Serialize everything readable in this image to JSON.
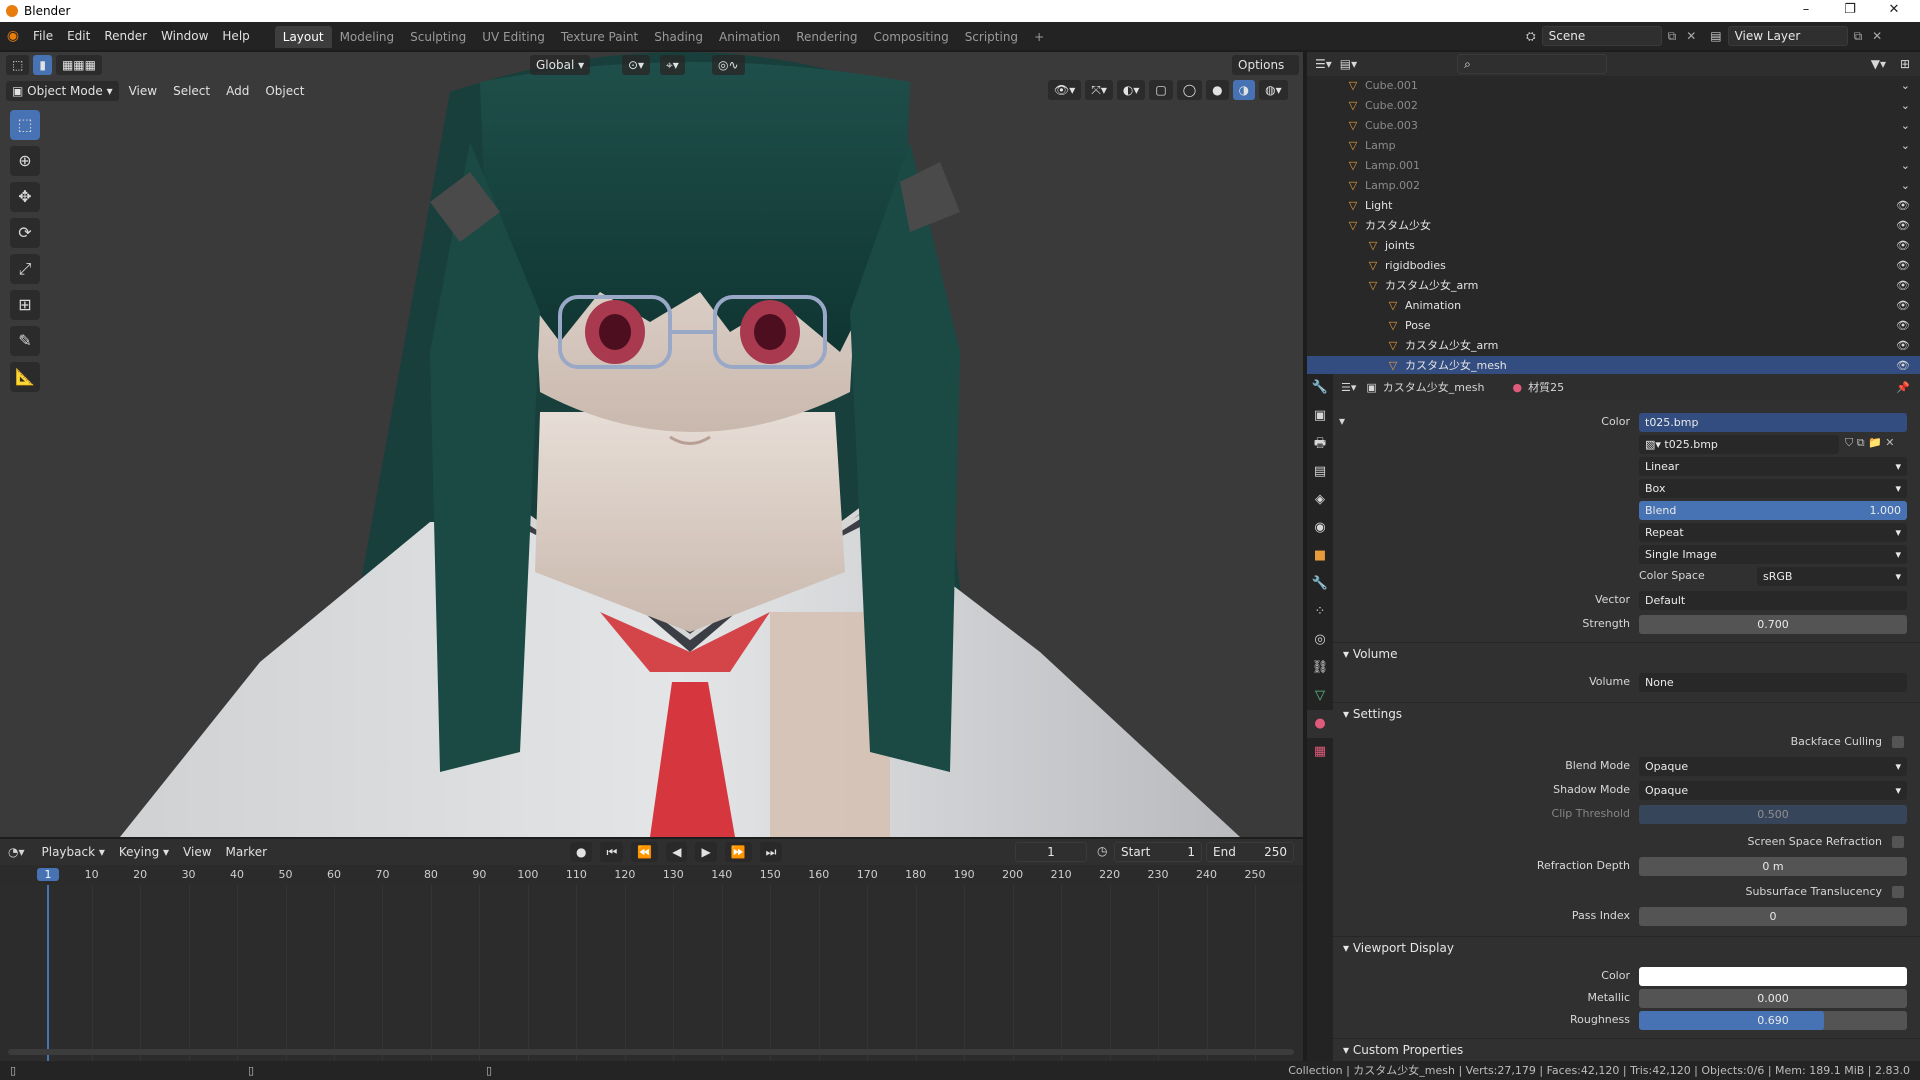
{
  "app": {
    "title": "Blender"
  },
  "menus": [
    "File",
    "Edit",
    "Render",
    "Window",
    "Help"
  ],
  "workspaces": [
    {
      "label": "Layout",
      "active": true
    },
    {
      "label": "Modeling"
    },
    {
      "label": "Sculpting"
    },
    {
      "label": "UV Editing"
    },
    {
      "label": "Texture Paint"
    },
    {
      "label": "Shading"
    },
    {
      "label": "Animation"
    },
    {
      "label": "Rendering"
    },
    {
      "label": "Compositing"
    },
    {
      "label": "Scripting"
    },
    {
      "label": "+"
    }
  ],
  "scene": {
    "name": "Scene",
    "view_layer": "View Layer"
  },
  "viewport": {
    "mode": "Object Mode",
    "menus": [
      "View",
      "Select",
      "Add",
      "Object"
    ],
    "orientation": "Global",
    "options": "Options"
  },
  "timeline": {
    "menus": [
      "Playback",
      "Keying",
      "View",
      "Marker"
    ],
    "current_frame": "1",
    "start_label": "Start",
    "start": "1",
    "end_label": "End",
    "end": "250",
    "ticks": [
      "1",
      "10",
      "20",
      "30",
      "40",
      "50",
      "60",
      "70",
      "80",
      "90",
      "100",
      "110",
      "120",
      "130",
      "140",
      "150",
      "160",
      "170",
      "180",
      "190",
      "200",
      "210",
      "220",
      "230",
      "240",
      "250"
    ]
  },
  "status": "Collection | カスタム少女_mesh | Verts:27,179 | Faces:42,120 | Tris:42,120 | Objects:0/6 | Mem: 189.1 MiB | 2.83.0",
  "outliner": {
    "items": [
      {
        "name": "Cube.001",
        "dim": true,
        "indent": 40
      },
      {
        "name": "Cube.002",
        "dim": true,
        "indent": 40
      },
      {
        "name": "Cube.003",
        "dim": true,
        "indent": 40
      },
      {
        "name": "Lamp",
        "dim": true,
        "indent": 40
      },
      {
        "name": "Lamp.001",
        "dim": true,
        "indent": 40
      },
      {
        "name": "Lamp.002",
        "dim": true,
        "indent": 40
      },
      {
        "name": "Light",
        "indent": 40
      },
      {
        "name": "カスタム少女",
        "indent": 40
      },
      {
        "name": "joints",
        "indent": 60
      },
      {
        "name": "rigidbodies",
        "indent": 60
      },
      {
        "name": "カスタム少女_arm",
        "indent": 60
      },
      {
        "name": "Animation",
        "indent": 80
      },
      {
        "name": "Pose",
        "indent": 80
      },
      {
        "name": "カスタム少女_arm",
        "indent": 80
      },
      {
        "name": "カスタム少女_mesh",
        "indent": 80,
        "selected": true
      }
    ]
  },
  "properties": {
    "object": "カスタム少女_mesh",
    "material": "材質25",
    "color_label": "Color",
    "color_value": "t025.bmp",
    "image_name": "t025.bmp",
    "interp": "Linear",
    "projection": "Box",
    "blend_label": "Blend",
    "blend_value": "1.000",
    "extension": "Repeat",
    "source": "Single Image",
    "colorspace_label": "Color Space",
    "colorspace": "sRGB",
    "vector_label": "Vector",
    "vector": "Default",
    "strength_label": "Strength",
    "strength": "0.700",
    "volume_panel": "Volume",
    "volume_label": "Volume",
    "volume": "None",
    "settings_panel": "Settings",
    "backface": "Backface Culling",
    "blend_mode_label": "Blend Mode",
    "blend_mode": "Opaque",
    "shadow_mode_label": "Shadow Mode",
    "shadow_mode": "Opaque",
    "clip_label": "Clip Threshold",
    "clip": "0.500",
    "ssr": "Screen Space Refraction",
    "refr_label": "Refraction Depth",
    "refr": "0 m",
    "sss": "Subsurface Translucency",
    "pass_label": "Pass Index",
    "pass": "0",
    "vd_panel": "Viewport Display",
    "vd_color_label": "Color",
    "metallic_label": "Metallic",
    "metallic": "0.000",
    "roughness_label": "Roughness",
    "roughness": "0.690",
    "custom_panel": "Custom Properties"
  },
  "colors": {
    "accent": "#4772b3",
    "selected_row": "#334d80",
    "header": "#232323"
  }
}
